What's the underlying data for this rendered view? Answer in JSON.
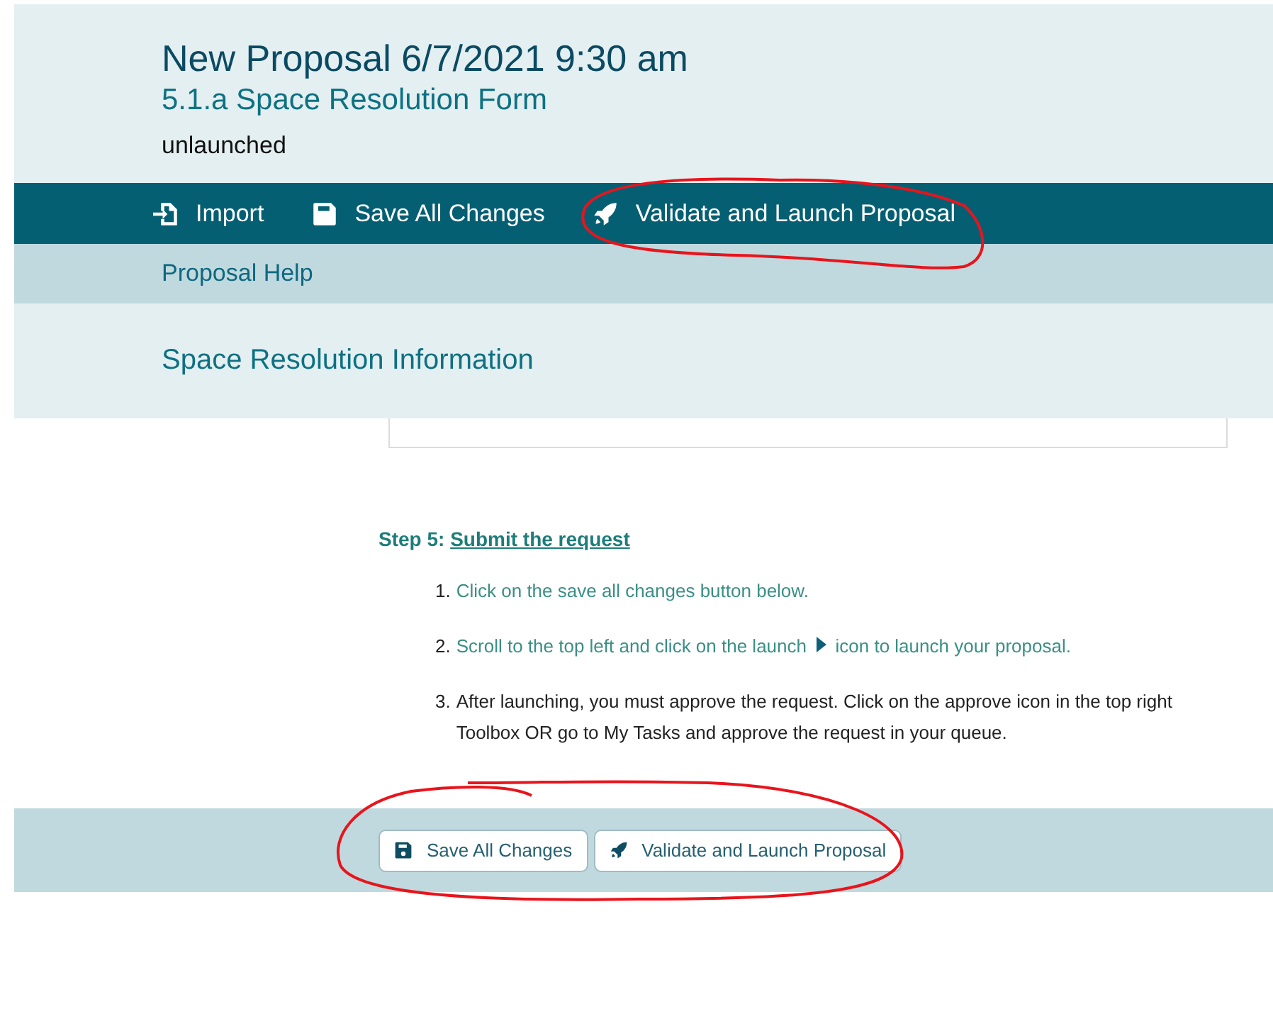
{
  "header": {
    "title": "New Proposal 6/7/2021 9:30 am",
    "subtitle": "5.1.a Space Resolution Form",
    "status": "unlaunched"
  },
  "toolbar": [
    {
      "kind": "import",
      "label": "Import"
    },
    {
      "kind": "save",
      "label": "Save All Changes"
    },
    {
      "kind": "launch",
      "label": "Validate and Launch Proposal"
    }
  ],
  "help_bar": {
    "link": "Proposal Help"
  },
  "section": {
    "title": "Space Resolution Information"
  },
  "step": {
    "prefix": "Step 5: ",
    "link": "Submit the request",
    "items": [
      {
        "number": "1.",
        "kind": "plain",
        "text": "Click on the save all changes button below.",
        "highlight": true
      },
      {
        "number": "2.",
        "kind": "icon",
        "text": "Scroll to the top left and click on the launch",
        "text_after": "icon to launch your proposal.",
        "highlight": true
      },
      {
        "number": "3.",
        "kind": "plain",
        "text": "After launching, you must approve the request. Click on the approve icon in the top right Toolbox OR go to My Tasks and approve the request in your queue.",
        "highlight": false
      }
    ]
  },
  "footer_buttons": [
    {
      "kind": "save",
      "label": "Save All Changes"
    },
    {
      "kind": "launch",
      "label": "Validate and Launch Proposal"
    }
  ]
}
